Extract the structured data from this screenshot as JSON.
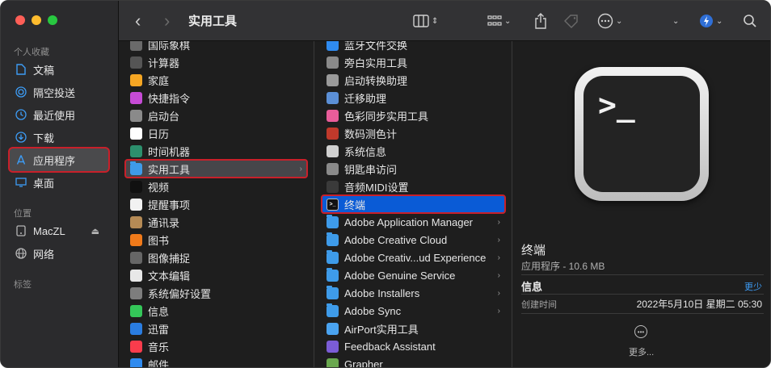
{
  "window": {
    "title": "实用工具"
  },
  "sidebar": {
    "section_favorites": "个人收藏",
    "favorites": [
      {
        "label": "文稿",
        "icon": "document-icon"
      },
      {
        "label": "隔空投送",
        "icon": "airdrop-icon"
      },
      {
        "label": "最近使用",
        "icon": "clock-icon"
      },
      {
        "label": "下载",
        "icon": "download-icon"
      },
      {
        "label": "应用程序",
        "icon": "applications-icon",
        "selected": true
      },
      {
        "label": "桌面",
        "icon": "desktop-icon"
      }
    ],
    "section_locations": "位置",
    "locations": [
      {
        "label": "MacZL",
        "icon": "disk-icon"
      },
      {
        "label": "网络",
        "icon": "network-icon"
      }
    ],
    "section_tags": "标签"
  },
  "toolbar": {
    "back": "‹",
    "forward": "›",
    "title": "实用工具"
  },
  "column_apps": {
    "items": [
      {
        "label": "国际象棋",
        "icon": "chess-icon",
        "color": "#6a6a6a"
      },
      {
        "label": "计算器",
        "icon": "calculator-icon",
        "color": "#555555"
      },
      {
        "label": "家庭",
        "icon": "home-icon",
        "color": "#f5a623"
      },
      {
        "label": "快捷指令",
        "icon": "shortcuts-icon",
        "color": "#c64bd6"
      },
      {
        "label": "启动台",
        "icon": "launchpad-icon",
        "color": "#8a8a8a"
      },
      {
        "label": "日历",
        "icon": "calendar-icon",
        "color": "#ffffff"
      },
      {
        "label": "时间机器",
        "icon": "time-machine-icon",
        "color": "#2c8f6d"
      },
      {
        "label": "实用工具",
        "icon": "folder-icon",
        "color": "#3e9be9",
        "selected": true,
        "folder": true
      },
      {
        "label": "视频",
        "icon": "tv-icon",
        "color": "#111111"
      },
      {
        "label": "提醒事项",
        "icon": "reminders-icon",
        "color": "#f2f2f2"
      },
      {
        "label": "通讯录",
        "icon": "contacts-icon",
        "color": "#b58a55"
      },
      {
        "label": "图书",
        "icon": "books-icon",
        "color": "#f07a1a"
      },
      {
        "label": "图像捕捉",
        "icon": "image-capture-icon",
        "color": "#666666"
      },
      {
        "label": "文本编辑",
        "icon": "textedit-icon",
        "color": "#e8e8e8"
      },
      {
        "label": "系统偏好设置",
        "icon": "system-prefs-icon",
        "color": "#7d7d7d"
      },
      {
        "label": "信息",
        "icon": "messages-icon",
        "color": "#34c759"
      },
      {
        "label": "迅雷",
        "icon": "thunder-icon",
        "color": "#2a7de1"
      },
      {
        "label": "音乐",
        "icon": "music-icon",
        "color": "#fa3c4c"
      },
      {
        "label": "邮件",
        "icon": "mail-icon",
        "color": "#2f8bf0"
      }
    ]
  },
  "column_utilities": {
    "items": [
      {
        "label": "蓝牙文件交换",
        "icon": "bluetooth-icon",
        "color": "#2f8bf0"
      },
      {
        "label": "旁白实用工具",
        "icon": "voiceover-icon",
        "color": "#8a8a8a"
      },
      {
        "label": "启动转换助理",
        "icon": "bootcamp-icon",
        "color": "#9a9a9a"
      },
      {
        "label": "迁移助理",
        "icon": "migration-icon",
        "color": "#5b8fd6"
      },
      {
        "label": "色彩同步实用工具",
        "icon": "colorsync-icon",
        "color": "#e85d9a"
      },
      {
        "label": "数码测色计",
        "icon": "colormeter-icon",
        "color": "#c0392b"
      },
      {
        "label": "系统信息",
        "icon": "system-info-icon",
        "color": "#d0d0d0"
      },
      {
        "label": "钥匙串访问",
        "icon": "keychain-icon",
        "color": "#8a8a8a"
      },
      {
        "label": "音频MIDI设置",
        "icon": "midi-icon",
        "color": "#3a3a3a"
      },
      {
        "label": "终端",
        "icon": "terminal-icon",
        "color": "#111111",
        "selected": true
      },
      {
        "label": "Adobe Application Manager",
        "icon": "folder-icon",
        "color": "#3e9be9",
        "folder": true
      },
      {
        "label": "Adobe Creative Cloud",
        "icon": "folder-icon",
        "color": "#3e9be9",
        "folder": true
      },
      {
        "label": "Adobe Creativ...ud Experience",
        "icon": "folder-icon",
        "color": "#3e9be9",
        "folder": true
      },
      {
        "label": "Adobe Genuine Service",
        "icon": "folder-icon",
        "color": "#3e9be9",
        "folder": true
      },
      {
        "label": "Adobe Installers",
        "icon": "folder-icon",
        "color": "#3e9be9",
        "folder": true
      },
      {
        "label": "Adobe Sync",
        "icon": "folder-icon",
        "color": "#3e9be9",
        "folder": true
      },
      {
        "label": "AirPort实用工具",
        "icon": "airport-icon",
        "color": "#4aa3f0"
      },
      {
        "label": "Feedback Assistant",
        "icon": "feedback-icon",
        "color": "#7b5cd6"
      },
      {
        "label": "Grapher",
        "icon": "grapher-icon",
        "color": "#6aa84f"
      }
    ]
  },
  "preview": {
    "terminal_prompt": ">_",
    "name": "终端",
    "subtitle": "应用程序 - 10.6 MB",
    "info_heading": "信息",
    "less_link": "更少",
    "created_label": "创建时间",
    "created_value": "2022年5月10日 星期二 05:30",
    "more_label": "更多..."
  }
}
